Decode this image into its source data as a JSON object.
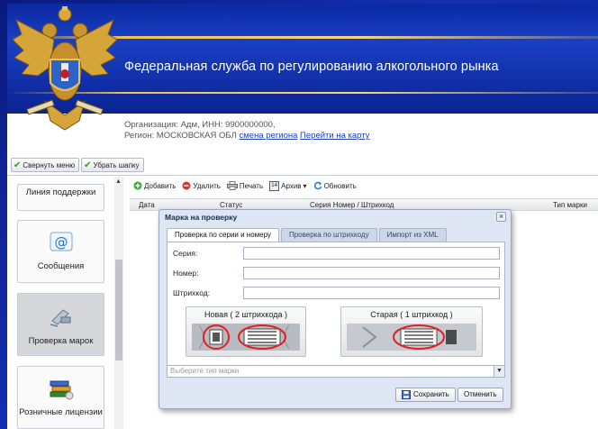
{
  "header": {
    "title": "Федеральная служба по регулированию алкогольного рынка"
  },
  "org": {
    "line1": "Организация: Адм, ИНН: 9900000000,",
    "region_prefix": "Регион: МОСКОВСКАЯ ОБЛ",
    "change_region": "смена региона",
    "go_to_map": "Перейти на карту"
  },
  "top_toolbar": {
    "collapse_menu": "Свернуть меню",
    "hide_header": "Убрать шапку"
  },
  "left_menu": {
    "items": [
      {
        "label": "Линия поддержки"
      },
      {
        "label": "Сообщения"
      },
      {
        "label": "Проверка марок"
      },
      {
        "label": "Розничные лицензии"
      }
    ]
  },
  "grid": {
    "toolbar": {
      "add": "Добавить",
      "delete": "Удалить",
      "print": "Печать",
      "archive": "Архив",
      "archive_badge": "14",
      "refresh": "Обновить"
    },
    "columns": {
      "date": "Дата",
      "status": "Статус",
      "series": "Серия Номер / Штрихкод",
      "type": "Тип марки"
    }
  },
  "dialog": {
    "title": "Марка на проверку",
    "close": "×",
    "tabs": [
      {
        "label": "Проверка по серии и номеру"
      },
      {
        "label": "Проверка по штрихкоду"
      },
      {
        "label": "Импорт из XML"
      }
    ],
    "fields": {
      "series_label": "Серия:",
      "number_label": "Номер:",
      "barcode_label": "Штрихкод:"
    },
    "marks": {
      "new_label": "Новая ( 2 штрихкода )",
      "old_label": "Старая ( 1 штрихкод )"
    },
    "type_placeholder": "Выберите тип марки",
    "save_button": "Сохранить",
    "cancel_button": "Отменить"
  },
  "colors": {
    "header_blue": "#0b2aa3",
    "accent_gold": "#f2c14e",
    "mark_circle": "#e02020"
  }
}
